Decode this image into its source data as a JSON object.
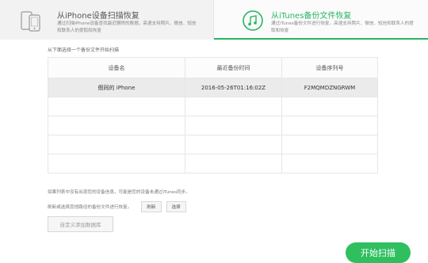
{
  "modes": [
    {
      "title": "从iPhone设备扫描恢复",
      "desc": "通过扫描iPhone设备查找最近删除的数据，高速支持照片、微信、短信和联系人的提取和恢复",
      "active": false
    },
    {
      "title": "从iTunes备份文件恢复",
      "desc": "通过iTunes备份文件进行恢复，高速支持照片、微信、短信和联系人的提取和恢复",
      "active": true
    }
  ],
  "hint": "从下面选择一个备份文件开始扫描",
  "table": {
    "headers": [
      "设备名",
      "最近备份时间",
      "设备序列号"
    ],
    "rows": [
      [
        "假同的 iPhone",
        "2016-05-26T01:16:02Z",
        "F2MQMDZNGRWM"
      ],
      [
        "",
        "",
        ""
      ],
      [
        "",
        "",
        ""
      ],
      [
        "",
        "",
        ""
      ],
      [
        "",
        "",
        ""
      ]
    ],
    "selected_row": 0
  },
  "note": "如果列表中没有出现您的设备信息，可能是您的设备未通过iTunes同步。",
  "refresh_label": "刷新或选择其他路径的备份文件进行恢复。",
  "refresh_button": "刷新",
  "choose_button": "选择",
  "custom_db_button": "自定义添加数据库",
  "start_button": "开始扫描",
  "colors": {
    "accent": "#28b463",
    "start": "#2fbf5f"
  },
  "icons": {
    "device": "iphone-icon",
    "itunes": "music-note-icon"
  }
}
